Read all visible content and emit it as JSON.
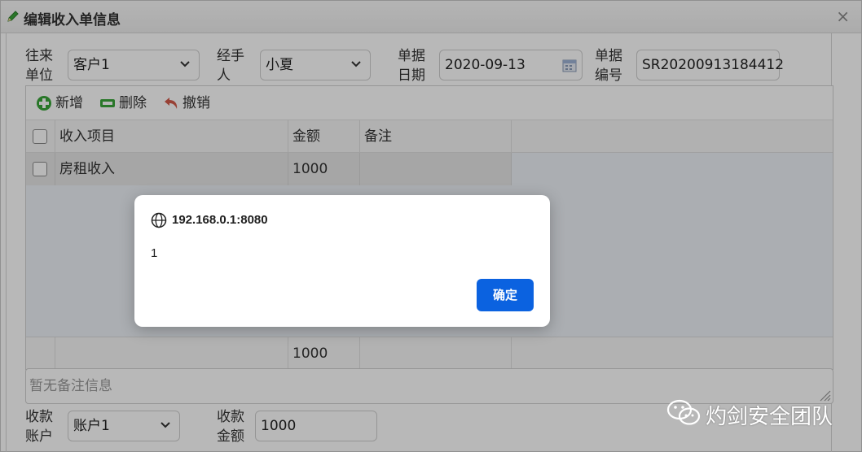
{
  "dialog": {
    "title": "编辑收入单信息",
    "close_glyph": "×",
    "title_icon": "pencil-icon"
  },
  "form": {
    "partner_label_1": "往来",
    "partner_label_2": "单位",
    "partner_value": "客户1",
    "handler_label_1": "经手",
    "handler_label_2": "人",
    "handler_value": "小夏",
    "date_label_1": "单据",
    "date_label_2": "日期",
    "date_value": "2020-09-13",
    "number_label_1": "单据",
    "number_label_2": "编号",
    "number_value": "SR20200913184412"
  },
  "toolbar": {
    "add_label": "新增",
    "delete_label": "删除",
    "undo_label": "撤销"
  },
  "grid": {
    "columns": [
      "收入项目",
      "金额",
      "备注"
    ],
    "rows": [
      {
        "item": "房租收入",
        "amount": "1000",
        "note": ""
      }
    ],
    "footer_amount": "1000"
  },
  "remark": {
    "placeholder": "暂无备注信息"
  },
  "payment": {
    "account_label_1": "收款",
    "account_label_2": "账户",
    "account_value": "账户1",
    "amount_label_1": "收款",
    "amount_label_2": "金额",
    "amount_value": "1000"
  },
  "alert": {
    "origin": "192.168.0.1:8080",
    "message": "1",
    "ok_label": "确定"
  },
  "watermark": {
    "text": "灼剑安全团队"
  },
  "colors": {
    "primary_button": "#0b62e0",
    "add_icon": "#2e9e2e",
    "delete_icon": "#2e9e2e",
    "undo_icon": "#c0392b"
  }
}
